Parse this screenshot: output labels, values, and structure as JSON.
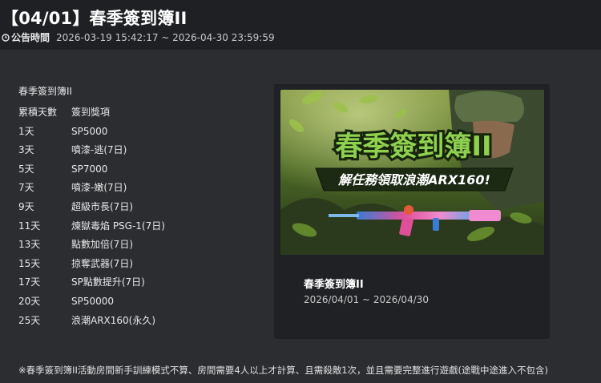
{
  "header": {
    "title": "【04/01】春季簽到簿II",
    "label": "公告時間",
    "time_range": "2026-03-19 15:42:17 ~ 2026-04-30 23:59:59"
  },
  "rewards": {
    "list_title": "春季簽到簿II",
    "headers": {
      "days": "累積天數",
      "item": "簽到獎項"
    },
    "rows": [
      {
        "days": "1天",
        "item": "SP5000"
      },
      {
        "days": "3天",
        "item": "噴漆-逃(7日)"
      },
      {
        "days": "5天",
        "item": "SP7000"
      },
      {
        "days": "7天",
        "item": "噴漆-嫩(7日)"
      },
      {
        "days": "9天",
        "item": "超級市長(7日)"
      },
      {
        "days": "11天",
        "item": "煉獄毒焰 PSG-1(7日)"
      },
      {
        "days": "13天",
        "item": "點數加倍(7日)"
      },
      {
        "days": "15天",
        "item": "掠奪武器(7日)"
      },
      {
        "days": "17天",
        "item": "SP點數提升(7日)"
      },
      {
        "days": "20天",
        "item": "SP50000"
      },
      {
        "days": "25天",
        "item": "浪潮ARX160(永久)"
      }
    ]
  },
  "event_card": {
    "banner_title": "春季簽到簿II",
    "banner_subtitle": "解任務領取浪潮ARX160!",
    "title": "春季簽到簿II",
    "date_range": "2026/04/01 ~ 2026/04/30"
  },
  "footnote": "※春季簽到簿II活動房間新手訓練模式不算、房間需要4人以上才計算、且需殺敵1次，並且需要完整進行遊戲(途戰中途進入不包含)",
  "colors": {
    "page_bg": "#2b2d31",
    "header_bg": "#1e2024",
    "card_bg": "#1f2125",
    "banner_title": "#8fd14f",
    "banner_ribbon": "#1c2a14"
  }
}
